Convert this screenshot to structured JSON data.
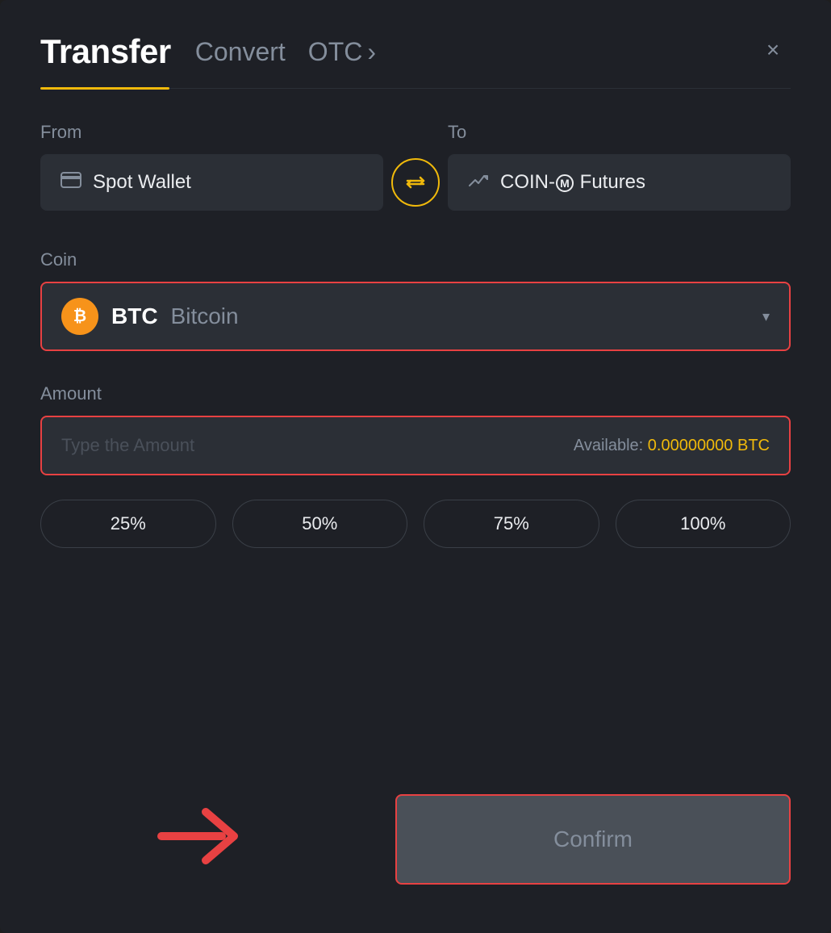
{
  "header": {
    "title": "Transfer",
    "nav": [
      {
        "label": "Convert",
        "id": "convert"
      },
      {
        "label": "OTC",
        "id": "otc"
      },
      {
        "otc_arrow": "›"
      }
    ],
    "close_label": "×"
  },
  "from_section": {
    "label": "From",
    "wallet": "Spot Wallet"
  },
  "to_section": {
    "label": "To",
    "wallet": "COIN-M Futures"
  },
  "coin_section": {
    "label": "Coin",
    "symbol": "BTC",
    "name": "Bitcoin"
  },
  "amount_section": {
    "label": "Amount",
    "placeholder": "Type the Amount",
    "available_label": "Available:",
    "available_value": "0.00000000 BTC"
  },
  "pct_buttons": [
    {
      "label": "25%"
    },
    {
      "label": "50%"
    },
    {
      "label": "75%"
    },
    {
      "label": "100%"
    }
  ],
  "confirm_button": {
    "label": "Confirm"
  },
  "colors": {
    "accent": "#f0b90b",
    "danger": "#e84142",
    "bg": "#1e2026",
    "surface": "#2b2f36",
    "text_primary": "#ffffff",
    "text_muted": "#848e9c"
  }
}
